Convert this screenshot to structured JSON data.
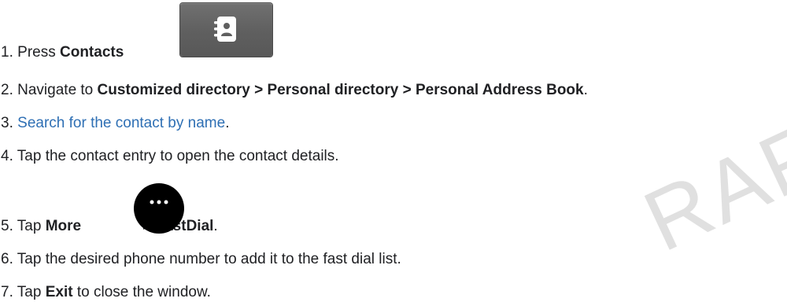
{
  "steps": [
    {
      "number": "1.",
      "prefix": "Press",
      "bold": "Contacts",
      "suffix": "."
    },
    {
      "number": "2.",
      "prefix": "Navigate to",
      "bold": "Customized directory > Personal directory > Personal Address Book",
      "suffix": "."
    },
    {
      "number": "3.",
      "link": "Search for the contact by name",
      "suffix": "."
    },
    {
      "number": "4.",
      "text": "Tap the contact entry to open the contact details."
    },
    {
      "number": "5.",
      "prefix": "Tap",
      "bold": "More",
      "bold2": "> FastDial",
      "suffix": "."
    },
    {
      "number": "6.",
      "text": "Tap the desired phone number to add it to the fast dial list."
    },
    {
      "number": "7.",
      "prefix": "Tap",
      "bold": "Exit",
      "suffix": "to close the window."
    }
  ],
  "icons": {
    "contacts": "contacts-book-icon",
    "more": "more-ellipsis-icon"
  },
  "watermark": "RAFT",
  "colors": {
    "link": "#2e6fb4",
    "text": "#202124",
    "watermark": "#e0e0e0"
  }
}
